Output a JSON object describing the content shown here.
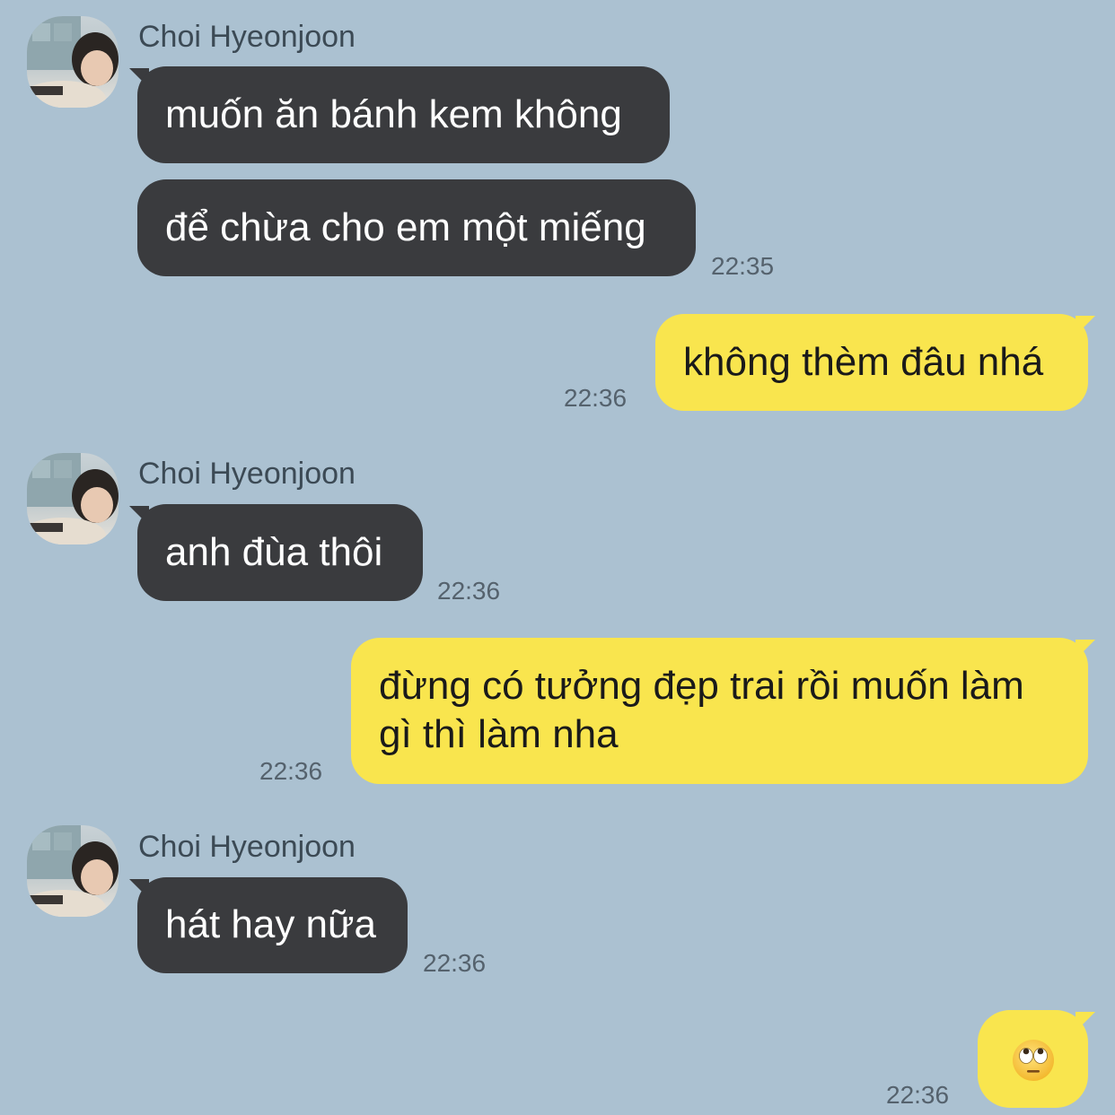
{
  "contact": {
    "name": "Choi Hyeonjoon"
  },
  "messages": [
    {
      "side": "in",
      "text": "muốn ăn bánh kem không"
    },
    {
      "side": "in",
      "text": "để chừa cho em một miếng",
      "time": "22:35"
    },
    {
      "side": "out",
      "text": "không thèm đâu nhá",
      "time": "22:36"
    },
    {
      "side": "in",
      "text": "anh đùa thôi",
      "time": "22:36"
    },
    {
      "side": "out",
      "text": "đừng có tưởng đẹp trai rồi muốn làm gì thì làm nha",
      "time": "22:36"
    },
    {
      "side": "in",
      "text": "hát hay nữa",
      "time": "22:36"
    },
    {
      "side": "out",
      "emoji": "face-with-rolling-eyes",
      "time": "22:36"
    }
  ],
  "colors": {
    "background": "#abc1d1",
    "incoming_bubble": "#3a3b3e",
    "outgoing_bubble": "#f9e54e",
    "timestamp": "#55626d"
  }
}
